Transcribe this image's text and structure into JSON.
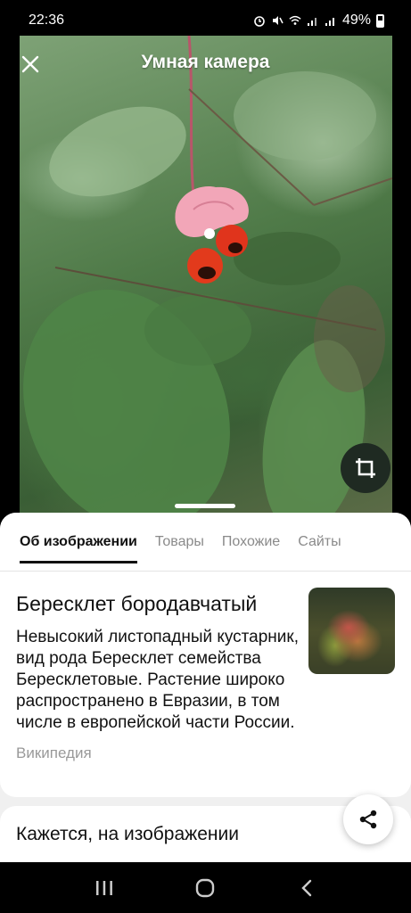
{
  "status_bar": {
    "time": "22:36",
    "battery": "49%",
    "icons": [
      "alarm-icon",
      "mute-icon",
      "wifi-icon",
      "signal-icon",
      "signal-icon",
      "battery-icon"
    ]
  },
  "camera": {
    "title": "Умная камера",
    "close_icon": "close-icon",
    "crop_icon": "crop-icon"
  },
  "tabs": [
    {
      "label": "Об изображении",
      "active": true
    },
    {
      "label": "Товары",
      "active": false
    },
    {
      "label": "Похожие",
      "active": false
    },
    {
      "label": "Сайты",
      "active": false
    }
  ],
  "result": {
    "title": "Бересклет бородавчатый",
    "description": "Невысокий листопадный кустарник, вид рода Бересклет семейства Бересклетовые. Растение широко распространено в Евразии, в том числе в европейской части России.",
    "source": "Википедия"
  },
  "second_card": {
    "title": "Кажется, на изображении"
  },
  "share_icon": "share-icon",
  "nav": [
    "recents-icon",
    "home-icon",
    "back-icon"
  ],
  "colors": {
    "sheet_bg": "#f0f0f0",
    "card_bg": "#ffffff",
    "text": "#111111",
    "muted": "#8a8a8a",
    "crop_button_bg": "#1f2a22"
  }
}
